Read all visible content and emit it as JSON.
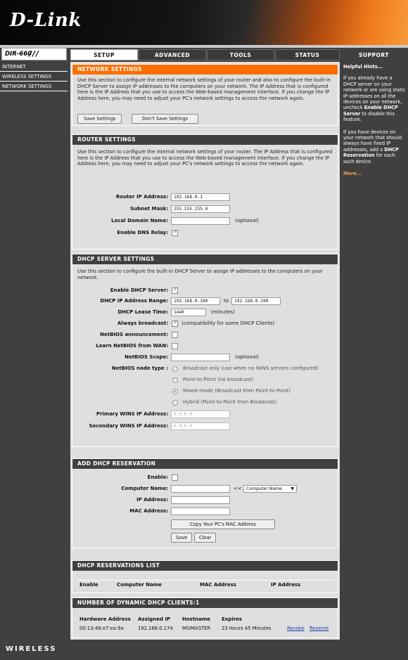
{
  "brand": {
    "logo": "D-Link",
    "model": "DIR-660",
    "model_bars": "///"
  },
  "nav": {
    "tabs": [
      "SETUP",
      "ADVANCED",
      "TOOLS",
      "STATUS"
    ],
    "support": "SUPPORT"
  },
  "sidebar": {
    "items": [
      {
        "label": "INTERNET"
      },
      {
        "label": "WIRELESS SETTINGS"
      },
      {
        "label": "NETWORK SETTINGS"
      }
    ]
  },
  "network": {
    "title": "NETWORK SETTINGS",
    "desc": "Use this section to configure the internal network settings of your router and also to configure the built-in DHCP Server to assign IP addresses to the computers on your network. The IP Address that is configured here is the IP Address that you use to access the Web-based management interface. If you change the IP Address here, you may need to adjust your PC's network settings to access the network again.",
    "save": "Save Settings",
    "dont_save": "Don't Save Settings"
  },
  "router": {
    "title": "ROUTER SETTINGS",
    "desc": "Use this section to configure the internal network settings of your router. The IP Address that is configured here is the IP Address that you use to access the Web-based management interface. If you change the IP Address here, you may need to adjust your PC's network settings to access the network again.",
    "ip_label": "Router IP Address:",
    "ip": "192.168.0.1",
    "mask_label": "Subnet Mask:",
    "mask": "255.255.255.0",
    "domain_label": "Local Domain Name:",
    "domain": "",
    "optional": "(optional)",
    "dns_label": "Enable DNS Relay:"
  },
  "dhcp": {
    "title": "DHCP SERVER SETTINGS",
    "desc": "Use this section to configure the built-in DHCP Server to assign IP addresses to the computers on your network.",
    "enable_label": "Enable DHCP Server:",
    "range_label": "DHCP IP Address Range:",
    "range_from": "192.168.0.100",
    "to": "to",
    "range_to": "192.168.0.199",
    "lease_label": "DHCP Lease Time:",
    "lease": "1440",
    "minutes": "(minutes)",
    "broadcast_label": "Always broadcast:",
    "broadcast_note": "(compatibility for some DHCP Clients)",
    "netbios_label": "NetBIOS announcement:",
    "learn_label": "Learn NetBIOS from WAN:",
    "scope_label": "NetBIOS Scope:",
    "scope": "",
    "optional": "(optional)",
    "node_label": "NetBIOS node type :",
    "node_options": [
      "Broadcast only (use when no WINS servers configured)",
      "Point-to-Point (no broadcast)",
      "Mixed-mode (Broadcast then Point-to-Point)",
      "Hybrid (Point-to-Point then Broadcast)"
    ],
    "primary_label": "Primary WINS IP Address:",
    "primary": "0.0.0.0",
    "secondary_label": "Secondary WINS IP Address:",
    "secondary": "0.0.0.0"
  },
  "reservation": {
    "title": "ADD DHCP RESERVATION",
    "enable_label": "Enable:",
    "computer_label": "Computer Name:",
    "computer": "",
    "arrows": "<<",
    "computer_select": "Computer Name",
    "ip_label": "IP Address:",
    "ip": "",
    "mac_label": "MAC Address:",
    "mac": "",
    "copy_btn": "Copy Your PC's MAC Address",
    "save": "Save",
    "clear": "Clear"
  },
  "res_list": {
    "title": "DHCP RESERVATIONS LIST",
    "cols": [
      "Enable",
      "Computer Name",
      "MAC Address",
      "IP Address"
    ]
  },
  "clients": {
    "title": "NUMBER OF DYNAMIC DHCP CLIENTS:1",
    "cols": [
      "Hardware Address",
      "Assigned IP",
      "Hostname",
      "Expires"
    ],
    "rows": [
      {
        "hw": "00:13:46:e7:ea:9a",
        "ip": "192.168.0.174",
        "host": "MSIMASTER",
        "expires": "23 Hours 45 Minutes",
        "revoke": "Revoke",
        "reserve": "Reserve"
      }
    ]
  },
  "support": {
    "heading": "Helpful Hints...",
    "p1a": "If you already have a DHCP server on your network or are using static IP addresses on all the devices on your network, uncheck ",
    "p1b": "Enable DHCP Server",
    "p1c": " to disable this feature.",
    "p2a": "If you have devices on your network that should always have fixed IP addresses, add a ",
    "p2b": "DHCP Reservation",
    "p2c": " for each such device.",
    "more": "More..."
  },
  "footer": {
    "text": "WIRELESS"
  }
}
